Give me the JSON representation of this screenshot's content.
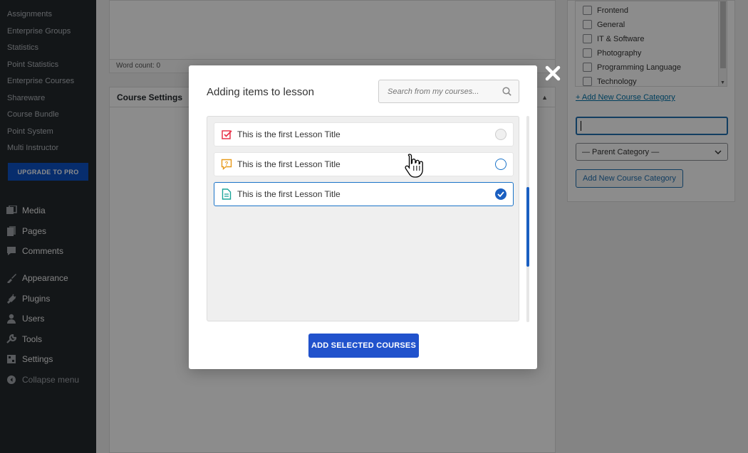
{
  "sidebar": {
    "sub_items": [
      "Assignments",
      "Enterprise Groups",
      "Statistics",
      "Point Statistics",
      "Enterprise Courses",
      "Shareware",
      "Course Bundle",
      "Point System",
      "Multi Instructor"
    ],
    "upgrade_label": "UPGRADE TO PRO",
    "menu": [
      {
        "label": "Media",
        "icon": "media-icon"
      },
      {
        "label": "Pages",
        "icon": "pages-icon"
      },
      {
        "label": "Comments",
        "icon": "comments-icon"
      },
      {
        "label": "Appearance",
        "icon": "appearance-icon"
      },
      {
        "label": "Plugins",
        "icon": "plugins-icon"
      },
      {
        "label": "Users",
        "icon": "users-icon"
      },
      {
        "label": "Tools",
        "icon": "tools-icon"
      },
      {
        "label": "Settings",
        "icon": "settings-icon"
      },
      {
        "label": "Collapse menu",
        "icon": "collapse-icon"
      }
    ]
  },
  "editor": {
    "word_count": "Word count: 0",
    "course_settings_title": "Course Settings"
  },
  "categories": {
    "items": [
      "Frontend",
      "General",
      "IT & Software",
      "Photography",
      "Programming Language",
      "Technology"
    ],
    "add_new_link": "+ Add New Course Category",
    "new_category_value": "",
    "parent_select": "— Parent Category —",
    "add_button": "Add New Course Category"
  },
  "modal": {
    "title": "Adding items to lesson",
    "search_placeholder": "Search from my courses...",
    "items": [
      {
        "label": "This is the first Lesson Title",
        "type": "quiz",
        "state": "unselected"
      },
      {
        "label": "This is the first Lesson Title",
        "type": "question",
        "state": "hover"
      },
      {
        "label": "This is the first Lesson Title",
        "type": "lesson",
        "state": "selected"
      }
    ],
    "add_button": "ADD SELECTED COURSES"
  },
  "colors": {
    "accent": "#2152cc",
    "sidebar_bg": "#23282d",
    "quiz_icon": "#e8334a",
    "question_icon": "#e89a1a",
    "lesson_icon": "#1aa59a"
  }
}
